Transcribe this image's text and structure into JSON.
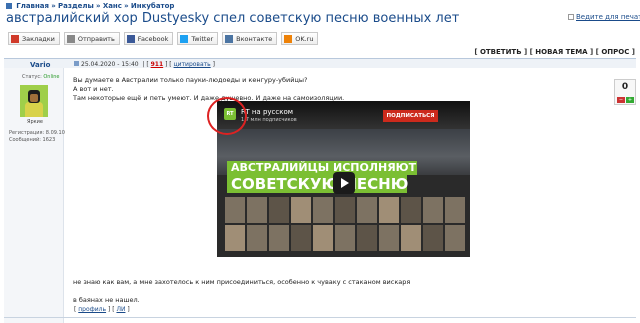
{
  "breadcrumbs": [
    "Главная",
    "Разделы",
    "Ханс",
    "Инкубатор"
  ],
  "breadcrumb_sep": "»",
  "topic_title": "австралийский хор Dustyesky спел советскую песню военных лет",
  "fav_label": "Ведите для печати",
  "share": [
    {
      "label": "Закладки",
      "icon": "bookmark-icon",
      "color": "#d03a2a"
    },
    {
      "label": "Отправить",
      "icon": "mail-icon",
      "color": "#888888"
    },
    {
      "label": "Facebook",
      "icon": "facebook-icon",
      "color": "#3b5998"
    },
    {
      "label": "Twitter",
      "icon": "twitter-icon",
      "color": "#1da1f2"
    },
    {
      "label": "Вконтакте",
      "icon": "vk-icon",
      "color": "#4c75a3"
    },
    {
      "label": "OK.ru",
      "icon": "ok-icon",
      "color": "#ee8208"
    }
  ],
  "actions": {
    "reply": "ОТВЕТИТЬ",
    "new_topic": "НОВАЯ ТЕМА",
    "poll": "ОПРОС"
  },
  "post": {
    "author": "Vario",
    "date": "25.04.2020 - 15:40",
    "post_num": "911",
    "quote": "цитировать",
    "status_label": "Статус:",
    "status_value": "Online",
    "rank": "Яркие",
    "meta_reg": "Регистрация: 8.09.10",
    "meta_msgs": "Сообщений: 1623",
    "lines": [
      "Вы думаете в Австралии только пауки-людоеды и кенгуру-убийцы?",
      "А вот и нет.",
      "Там некоторые ещё и петь умеют. И даже душевно. И даже на самоизоляции."
    ],
    "after_line": "не знаю как вам, а мне захотелось к ним присоединиться, особенно к чуваку с стаканом вискаря",
    "last_line": "в баянах не нашел.",
    "rating": "0",
    "rating_minus": "−",
    "rating_plus": "+",
    "profile_link": "профиль",
    "pm_link": "ЛИ"
  },
  "video": {
    "logo": "RT",
    "channel": "RT на русском",
    "subscribers": "1,7 млн подписчиков",
    "subscribe": "ПОДПИСАТЬСЯ",
    "banner_top": "АВСТРАЛИЙЦЫ ИСПОЛНЯЮТ",
    "banner_bottom": "СОВЕТСКУЮ ПЕСНЮ"
  }
}
